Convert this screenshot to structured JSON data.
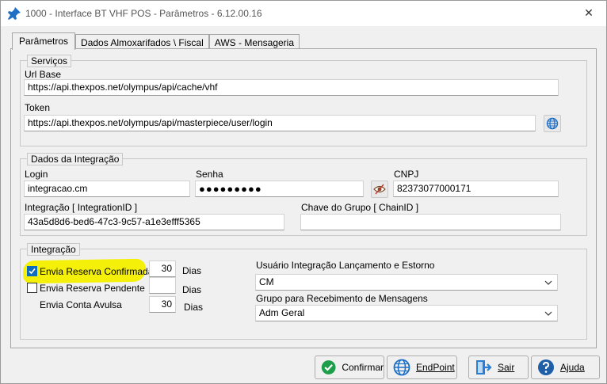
{
  "window": {
    "title": "1000 - Interface BT VHF POS - Parâmetros - 6.12.00.16",
    "close_glyph": "✕"
  },
  "tabs": [
    {
      "label": "Parâmetros"
    },
    {
      "label": "Dados Almoxarifados \\ Fiscal"
    },
    {
      "label": "AWS - Mensageria"
    }
  ],
  "servicos": {
    "legend": "Serviços",
    "url_base_label": "Url Base",
    "url_base_value": "https://api.thexpos.net/olympus/api/cache/vhf",
    "token_label": "Token",
    "token_value": "https://api.thexpos.net/olympus/api/masterpiece/user/login",
    "globe_icon": "globe-icon"
  },
  "dados_integracao": {
    "legend": "Dados da Integração",
    "login_label": "Login",
    "login_value": "integracao.cm",
    "senha_label": "Senha",
    "senha_value": "●●●●●●●●●",
    "cnpj_label": "CNPJ",
    "cnpj_value": "82373077000171",
    "integracao_label": "Integração [ IntegrationID ]",
    "integracao_value": "43a5d8d6-bed6-47c3-9c57-a1e3efff5365",
    "chave_label": "Chave do Grupo  [ ChainID ]",
    "chave_value": ""
  },
  "integracao": {
    "legend": "Integração",
    "envia_confirmada_label": "Envia Reserva Confirmada",
    "envia_confirmada_checked": true,
    "envia_confirmada_days": "30",
    "envia_pendente_label": "Envia Reserva Pendente",
    "envia_pendente_checked": false,
    "envia_pendente_days": "",
    "envia_conta_label": "Envia Conta Avulsa",
    "envia_conta_days": "30",
    "dias_label": "Dias",
    "usuario_label": "Usuário Integração Lançamento e Estorno",
    "usuario_value": "CM",
    "grupo_label": "Grupo para Recebimento de Mensagens",
    "grupo_value": "Adm Geral"
  },
  "buttons": {
    "confirmar": "Confirmar",
    "endpoint": "EndPoint",
    "sair": "Sair",
    "ajuda": "Ajuda"
  },
  "colors": {
    "accent": "#0f6cbd",
    "highlight": "#f5f00a",
    "confirm_green": "#1e9e4a"
  }
}
